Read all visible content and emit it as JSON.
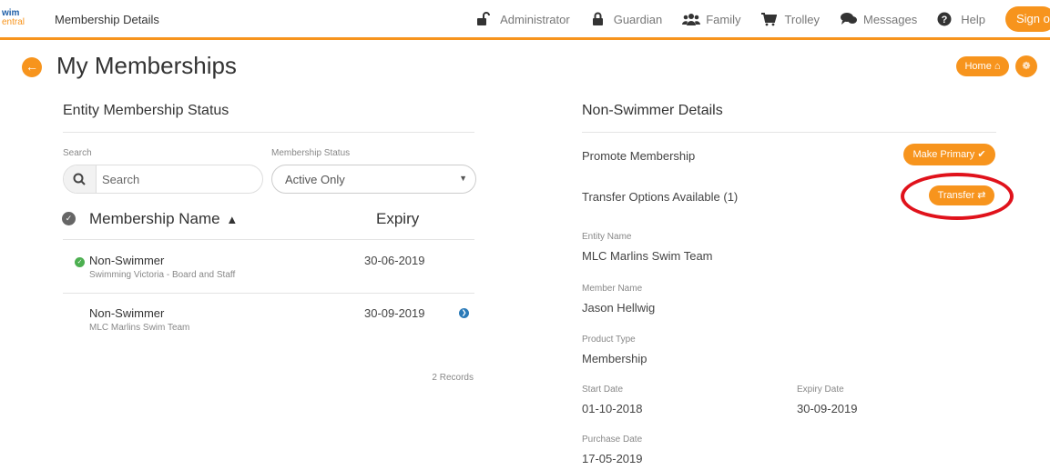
{
  "header": {
    "logo_line1": "wim",
    "logo_line2": "entral",
    "title": "Membership Details",
    "nav": [
      {
        "label": "Administrator",
        "icon": "unlock-icon"
      },
      {
        "label": "Guardian",
        "icon": "lock-icon"
      },
      {
        "label": "Family",
        "icon": "users-icon"
      },
      {
        "label": "Trolley",
        "icon": "cart-icon"
      },
      {
        "label": "Messages",
        "icon": "chat-icon"
      },
      {
        "label": "Help",
        "icon": "help-icon"
      }
    ],
    "sign_out_label": "Sign o"
  },
  "page": {
    "title": "My Memberships",
    "home_label": "Home",
    "accent_color": "#f7941d"
  },
  "left": {
    "section_title": "Entity Membership Status",
    "search_label": "Search",
    "search_placeholder": "Search",
    "status_label": "Membership Status",
    "status_value": "Active Only",
    "col_name": "Membership Name",
    "col_expiry": "Expiry",
    "rows": [
      {
        "name": "Non-Swimmer",
        "entity": "Swimming Victoria - Board and Staff",
        "expiry": "30-06-2019",
        "status": "active"
      },
      {
        "name": "Non-Swimmer",
        "entity": "MLC Marlins Swim Team",
        "expiry": "30-09-2019",
        "status": "selected"
      }
    ],
    "records": "2 Records"
  },
  "right": {
    "section_title": "Non-Swimmer Details",
    "promote_label": "Promote Membership",
    "make_primary_label": "Make Primary",
    "transfer_options_label": "Transfer Options Available (1)",
    "transfer_label": "Transfer",
    "highlight_color": "#e0121b",
    "fields": {
      "entity_name_label": "Entity Name",
      "entity_name": "MLC Marlins Swim Team",
      "member_name_label": "Member Name",
      "member_name": "Jason Hellwig",
      "product_type_label": "Product Type",
      "product_type": "Membership",
      "start_date_label": "Start Date",
      "start_date": "01-10-2018",
      "expiry_date_label": "Expiry Date",
      "expiry_date": "30-09-2019",
      "purchase_date_label": "Purchase Date",
      "purchase_date": "17-05-2019"
    }
  }
}
